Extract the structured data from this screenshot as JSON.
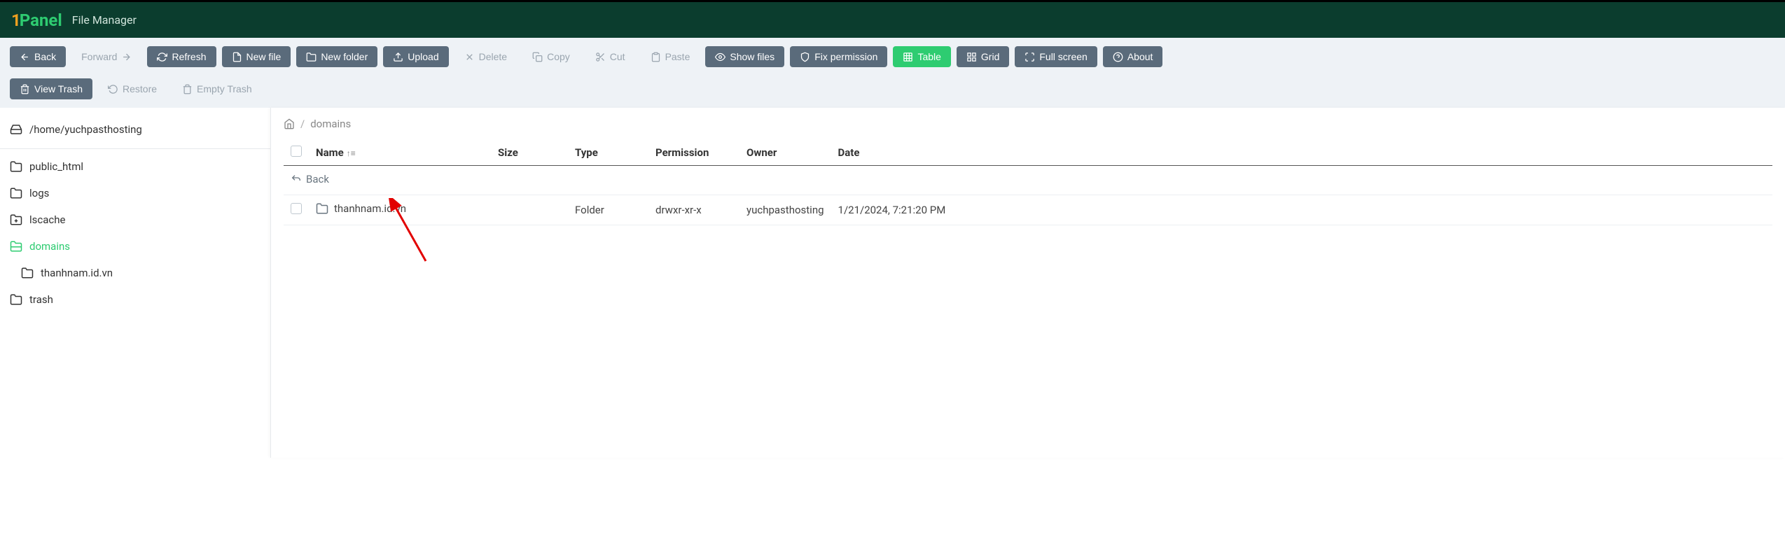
{
  "header": {
    "logo_one": "1",
    "logo_panel": "Panel",
    "title": "File Manager"
  },
  "toolbar": {
    "back": "Back",
    "forward": "Forward",
    "refresh": "Refresh",
    "new_file": "New file",
    "new_folder": "New folder",
    "upload": "Upload",
    "delete": "Delete",
    "copy": "Copy",
    "cut": "Cut",
    "paste": "Paste",
    "show_files": "Show files",
    "fix_permission": "Fix permission",
    "table": "Table",
    "grid": "Grid",
    "full_screen": "Full screen",
    "about": "About",
    "view_trash": "View Trash",
    "restore": "Restore",
    "empty_trash": "Empty Trash"
  },
  "sidebar": {
    "root_path": "/home/yuchpasthosting",
    "items": [
      {
        "label": "public_html",
        "active": false
      },
      {
        "label": "logs",
        "active": false
      },
      {
        "label": "lscache",
        "active": false
      },
      {
        "label": "domains",
        "active": true
      },
      {
        "label": "thanhnam.id.vn",
        "active": false,
        "child": true
      },
      {
        "label": "trash",
        "active": false
      }
    ]
  },
  "breadcrumb": {
    "current": "domains"
  },
  "table": {
    "headers": {
      "name": "Name",
      "size": "Size",
      "type": "Type",
      "permission": "Permission",
      "owner": "Owner",
      "date": "Date"
    },
    "back_label": "Back",
    "rows": [
      {
        "name": "thanhnam.id.vn",
        "size": "",
        "type": "Folder",
        "permission": "drwxr-xr-x",
        "owner": "yuchpasthosting",
        "date": "1/21/2024, 7:21:20 PM"
      }
    ]
  }
}
